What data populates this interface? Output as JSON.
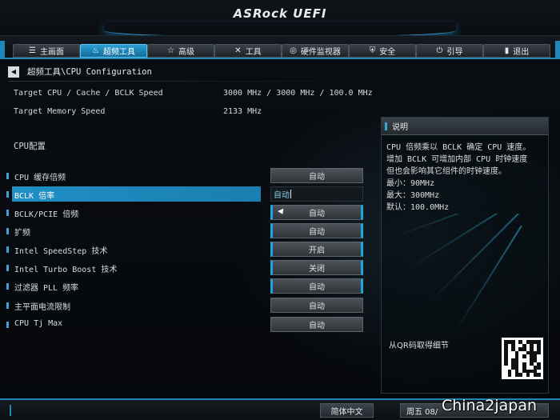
{
  "header": {
    "logo": "ASRock UEFI"
  },
  "tabs": [
    {
      "label": "主画面",
      "icon": "list-icon"
    },
    {
      "label": "超频工具",
      "icon": "flame-icon",
      "active": true
    },
    {
      "label": "高级",
      "icon": "star-icon"
    },
    {
      "label": "工具",
      "icon": "tools-icon"
    },
    {
      "label": "硬件监视器",
      "icon": "monitor-icon"
    },
    {
      "label": "安全",
      "icon": "shield-icon"
    },
    {
      "label": "引导",
      "icon": "power-icon"
    },
    {
      "label": "退出",
      "icon": "exit-icon"
    }
  ],
  "breadcrumb": "超频工具\\CPU Configuration",
  "info": {
    "target_cpu_label": "Target CPU / Cache / BCLK Speed",
    "target_cpu_value": "3000 MHz / 3000 MHz / 100.0 MHz",
    "target_mem_label": "Target Memory Speed",
    "target_mem_value": "2133 MHz"
  },
  "section_title": "CPU配置",
  "settings": [
    {
      "name": "CPU 缓存倍频",
      "value": "自动"
    },
    {
      "name": "BCLK 倍率",
      "value": "自动",
      "selected": true
    },
    {
      "name": "BCLK/PCIE 倍频",
      "value": "自动"
    },
    {
      "name": "扩频",
      "value": "自动"
    },
    {
      "name": "Intel SpeedStep 技术",
      "value": "开启"
    },
    {
      "name": "Intel Turbo Boost 技术",
      "value": "关闭"
    },
    {
      "name": "过滤器 PLL 频率",
      "value": "自动"
    },
    {
      "name": "主平面电流限制",
      "value": "自动"
    },
    {
      "name": "CPU Tj Max",
      "value": "自动"
    }
  ],
  "description": {
    "title": "说明",
    "lines": [
      "CPU 倍频乘以 BCLK 确定 CPU 速度。",
      "增加 BCLK 可增加内部 CPU 时钟速度",
      "但也会影响其它组件的时钟速度。",
      "最小：90MHz",
      "最大：300MHz",
      "默认：100.0MHz"
    ],
    "qr_label": "从QR码取得细节"
  },
  "footer": {
    "language": "简体中文",
    "clock": "周五 08/"
  },
  "watermark": "China2japan",
  "colors": {
    "accent": "#1f8fc4",
    "glow": "#1fa5dd"
  }
}
